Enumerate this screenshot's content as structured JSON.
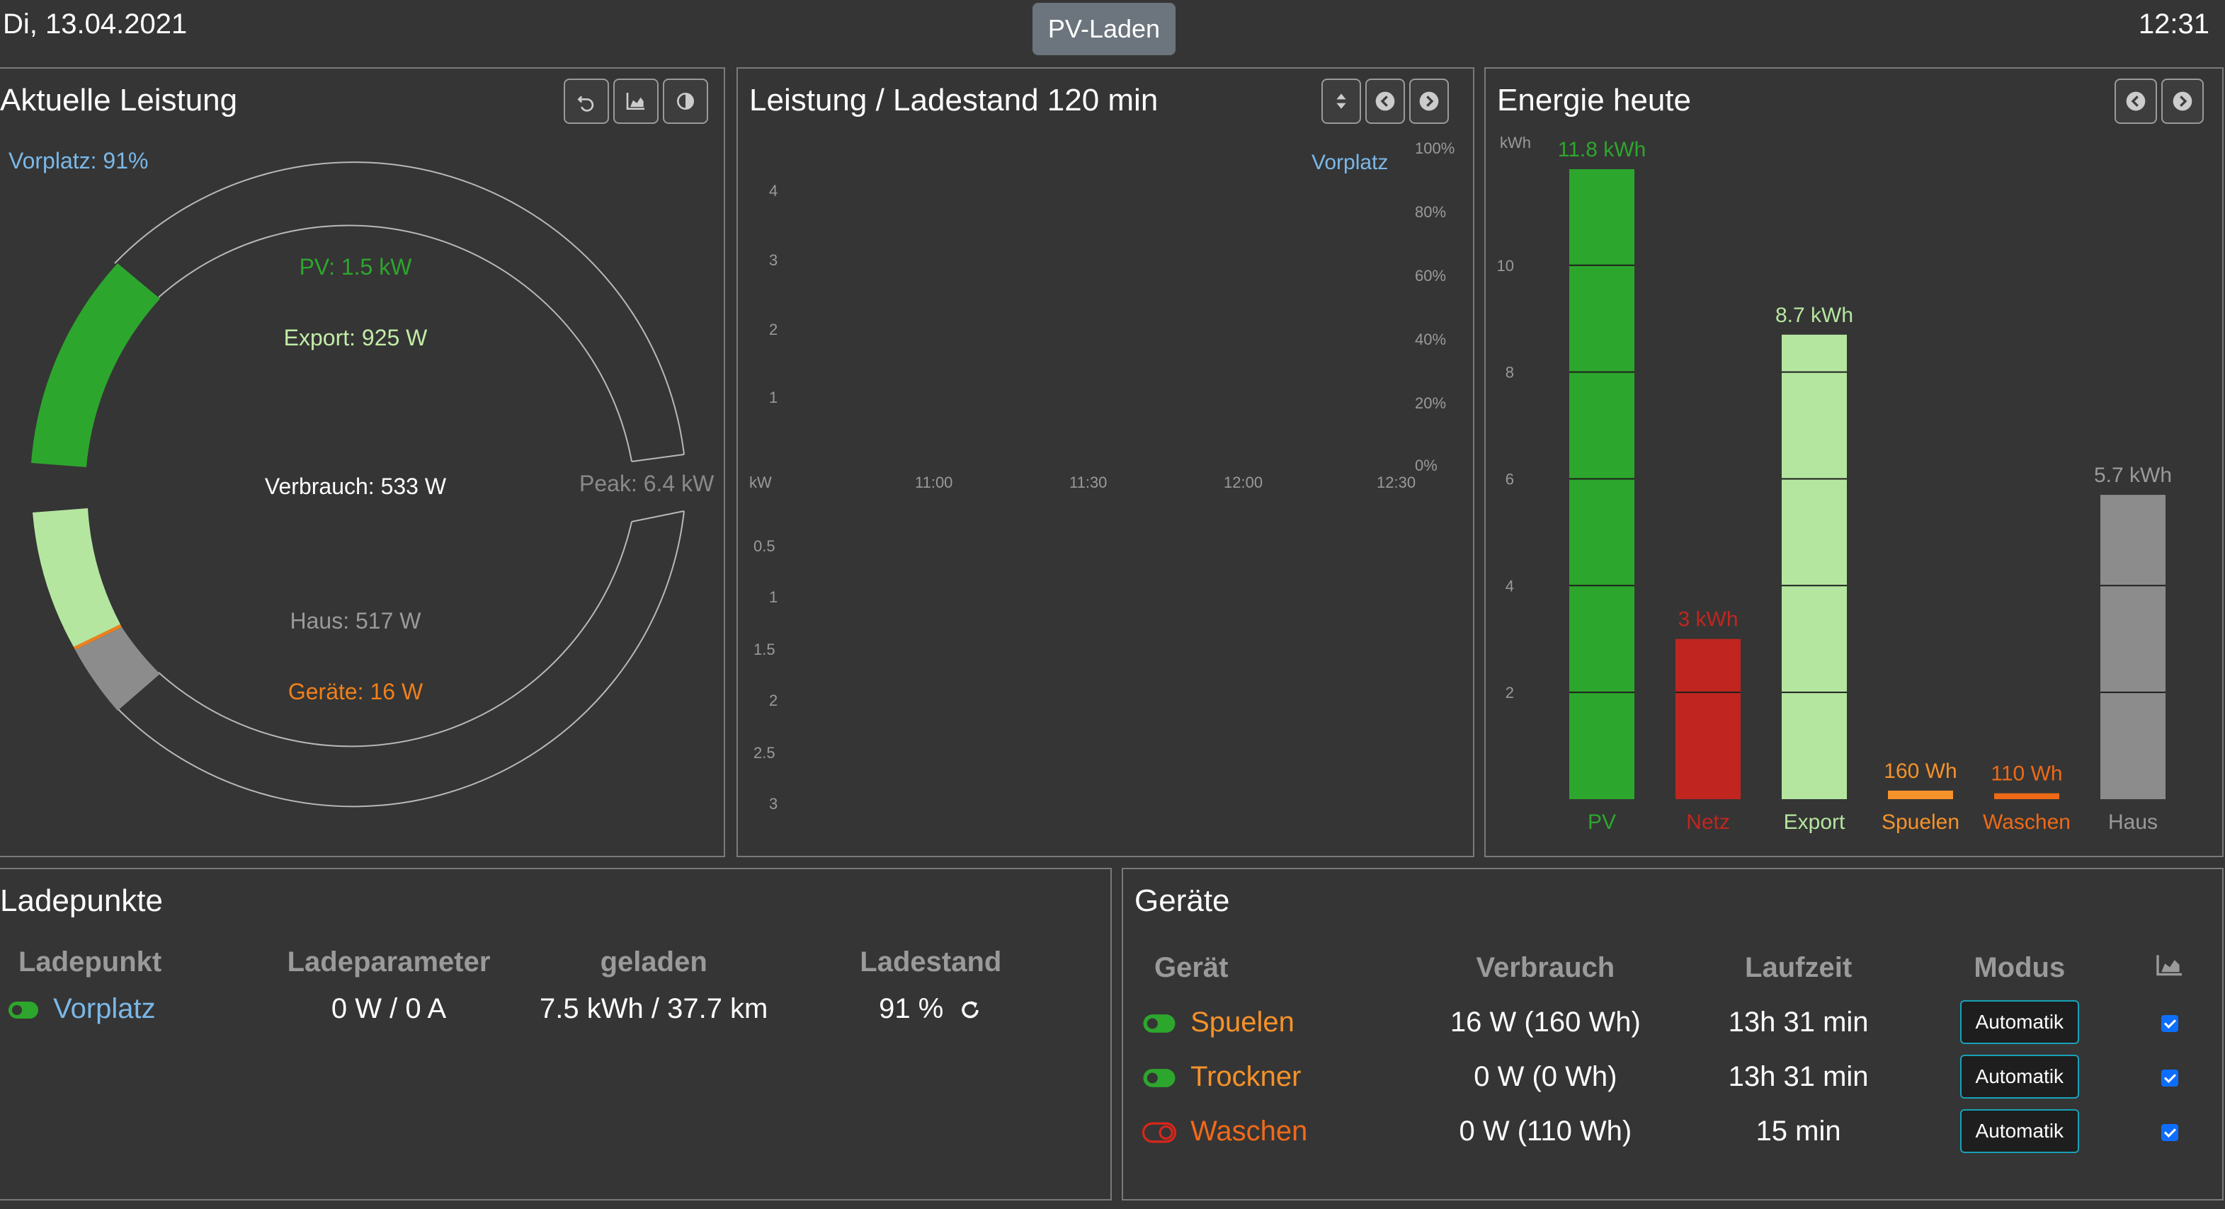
{
  "header": {
    "date": "Di, 13.04.2021",
    "title": "PV-Laden",
    "time": "12:31"
  },
  "power_panel": {
    "title": "Aktuelle Leistung",
    "top_label": "Vorplatz: 91%",
    "pv": "PV: 1.5 kW",
    "export": "Export: 925 W",
    "consumption": "Verbrauch: 533 W",
    "peak": "Peak: 6.4 kW",
    "house": "Haus: 517 W",
    "devices": "Geräte: 16 W",
    "icons": [
      "undo-icon",
      "area-chart-icon",
      "contrast-icon"
    ],
    "colors": {
      "pv": "#2da62d",
      "export": "#b5e6a0",
      "house": "#8c8c8c",
      "devices": "#f0801a",
      "soc": "#7ab8e8"
    }
  },
  "power_chart": {
    "title": "Leistung / Ladestand 120 min",
    "icons": [
      "sort-icon",
      "prev-icon",
      "next-icon"
    ],
    "x_ticks": [
      "11:00",
      "11:30",
      "12:00",
      "12:30"
    ],
    "y_top_ticks": [
      "4",
      "3",
      "2",
      "1"
    ],
    "y_top_unit": "kW",
    "y_right_ticks": [
      "100%",
      "80%",
      "60%",
      "40%",
      "20%",
      "0%"
    ],
    "y_bottom_ticks": [
      "0.5",
      "1",
      "1.5",
      "2",
      "2.5",
      "3"
    ],
    "series_label": "Vorplatz",
    "colors": {
      "export": "#b5e6a0",
      "pv": "#2da62d",
      "house": "#909090",
      "devices": "#e05a10",
      "soc": "#7ab8e8"
    }
  },
  "energy_panel": {
    "title": "Energie heute",
    "icons": [
      "prev-icon",
      "next-icon"
    ]
  },
  "chart_data": {
    "type": "bar",
    "title": "Energie heute",
    "ylabel": "kWh",
    "ylim": [
      0,
      11.8
    ],
    "yticks": [
      "2",
      "4",
      "6",
      "8",
      "10"
    ],
    "categories": [
      "PV",
      "Netz",
      "Export",
      "Spuelen",
      "Waschen",
      "Haus"
    ],
    "values": [
      11.8,
      3.0,
      8.7,
      0.16,
      0.11,
      5.7
    ],
    "value_labels": [
      "11.8 kWh",
      "3 kWh",
      "8.7 kWh",
      "160 Wh",
      "110 Wh",
      "5.7 kWh"
    ],
    "colors": [
      "#2da62d",
      "#c0261f",
      "#b5e6a0",
      "#f5922a",
      "#ee6a16",
      "#8c8c8c"
    ],
    "label_colors": [
      "#2da62d",
      "#c0261f",
      "#b5e6a0",
      "#f5922a",
      "#ee6a16",
      "#9a9a9a"
    ],
    "grid": true
  },
  "ladepunkte": {
    "title": "Ladepunkte",
    "headers": [
      "Ladepunkt",
      "Ladeparameter",
      "geladen",
      "Ladestand"
    ],
    "rows": [
      {
        "name": "Vorplatz",
        "params": "0 W / 0 A",
        "charged": "7.5 kWh / 37.7 km",
        "soc": "91 %"
      }
    ]
  },
  "geraete": {
    "title": "Geräte",
    "headers": [
      "Gerät",
      "Verbrauch",
      "Laufzeit",
      "Modus"
    ],
    "rows": [
      {
        "name": "Spuelen",
        "usage": "16 W (160 Wh)",
        "runtime": "13h 31 min",
        "mode": "Automatik"
      },
      {
        "name": "Trockner",
        "usage": "0 W (0 Wh)",
        "runtime": "13h 31 min",
        "mode": "Automatik"
      },
      {
        "name": "Waschen",
        "usage": "0 W (110 Wh)",
        "runtime": "15 min",
        "mode": "Automatik"
      }
    ]
  }
}
